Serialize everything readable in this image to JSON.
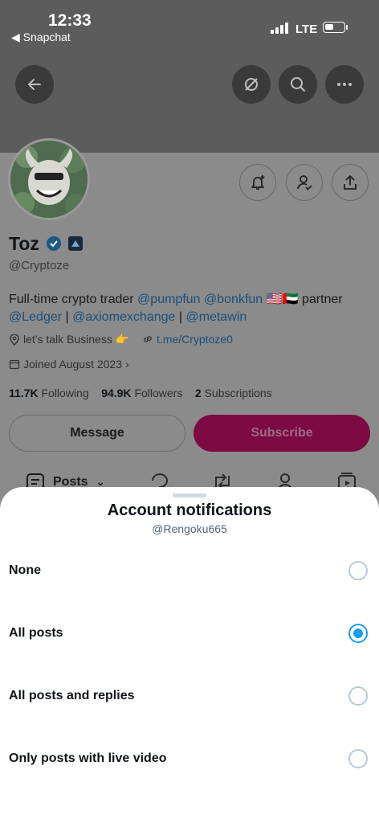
{
  "status_bar": {
    "time": "12:33",
    "back_app": "◀ Snapchat",
    "network": "LTE"
  },
  "profile": {
    "name": "Toz",
    "handle": "@Cryptoze",
    "bio_prefix": "Full-time crypto trader ",
    "bio_mention_1": "@pumpfun",
    "bio_mention_2": "@bonkfun",
    "bio_flags": " 🇺🇸🇦🇪 partner",
    "bio_mention_3": "@Ledger",
    "bio_sep_1": " | ",
    "bio_mention_4": "@axiomexchange",
    "bio_sep_2": " | ",
    "bio_mention_5": "@metawin",
    "location": "let's talk Business 👉",
    "website": "t.me/Cryptoze0",
    "joined": "Joined August 2023",
    "following_count": "11.7K",
    "following_label": "Following",
    "followers_count": "94.9K",
    "followers_label": "Followers",
    "subscriptions_count": "2",
    "subscriptions_label": "Subscriptions"
  },
  "actions": {
    "message": "Message",
    "subscribe": "Subscribe"
  },
  "tabs": {
    "posts": "Posts"
  },
  "sheet": {
    "title": "Account notifications",
    "subtitle": "@Rengoku665",
    "options": [
      {
        "label": "None",
        "selected": false
      },
      {
        "label": "All posts",
        "selected": true
      },
      {
        "label": "All posts and replies",
        "selected": false
      },
      {
        "label": "Only posts with live video",
        "selected": false
      }
    ]
  },
  "colors": {
    "accent": "#1d9bf0",
    "subscribe_bg": "#7c0a43",
    "overlay": "#8b8b8b"
  }
}
